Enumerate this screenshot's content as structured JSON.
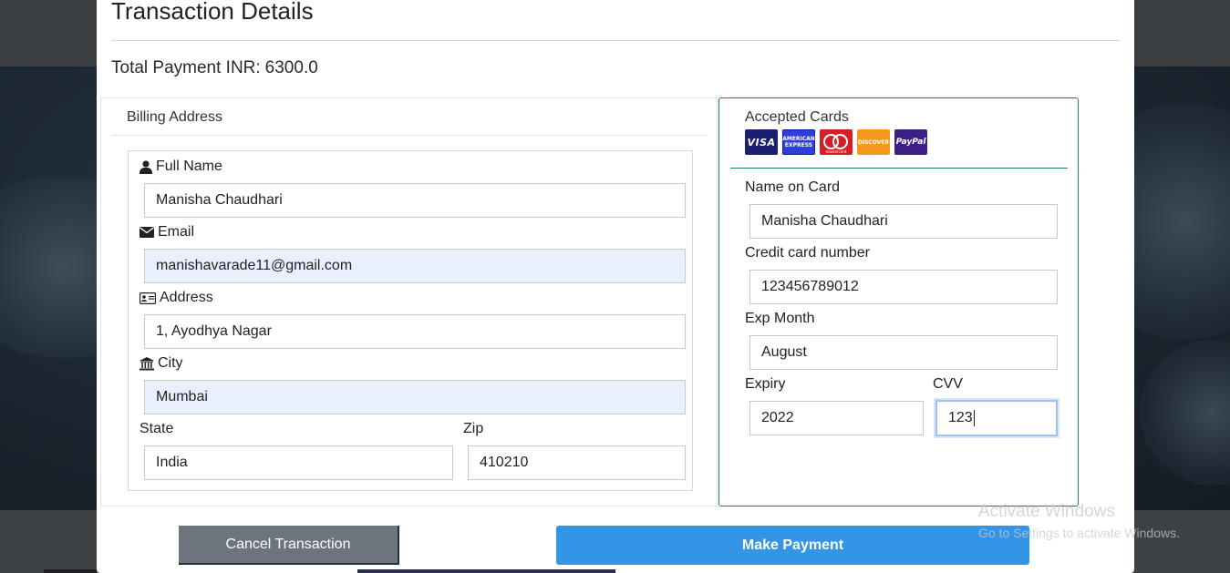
{
  "modal": {
    "title": "Transaction Details",
    "total_label": "Total Payment INR:",
    "total_value": "6300.0"
  },
  "billing": {
    "heading": "Billing Address",
    "full_name_label": "Full Name",
    "full_name_value": "Manisha Chaudhari",
    "email_label": "Email",
    "email_value": "manishavarade11@gmail.com",
    "address_label": "Address",
    "address_value": "1, Ayodhya Nagar",
    "city_label": "City",
    "city_value": "Mumbai",
    "state_label": "State",
    "state_value": "India",
    "zip_label": "Zip",
    "zip_value": "410210"
  },
  "payment": {
    "accepted_cards_label": "Accepted Cards",
    "cards": [
      {
        "name": "visa-logo",
        "text": "VISA"
      },
      {
        "name": "amex-logo",
        "text": "AMERICAN EXPRESS"
      },
      {
        "name": "mastercard-logo",
        "text": "mastercard"
      },
      {
        "name": "discover-logo",
        "text": "DISCOVER"
      },
      {
        "name": "paypal-logo",
        "text": "PayPal"
      }
    ],
    "name_on_card_label": "Name on Card",
    "name_on_card_value": "Manisha Chaudhari",
    "card_number_label": "Credit card number",
    "card_number_value": "123456789012",
    "exp_month_label": "Exp Month",
    "exp_month_value": "August",
    "expiry_label": "Expiry",
    "expiry_value": "2022",
    "cvv_label": "CVV",
    "cvv_value": "123"
  },
  "buttons": {
    "cancel_label": "Cancel Transaction",
    "pay_label": "Make Payment"
  },
  "watermark": {
    "title": "Activate Windows",
    "subtitle": "Go to Settings to activate Windows."
  },
  "colors": {
    "pay_button": "#3495e6",
    "cancel_button": "#6c757d",
    "payment_card_border": "#1f7a6e",
    "autofill_bg": "#e8f0fe"
  }
}
